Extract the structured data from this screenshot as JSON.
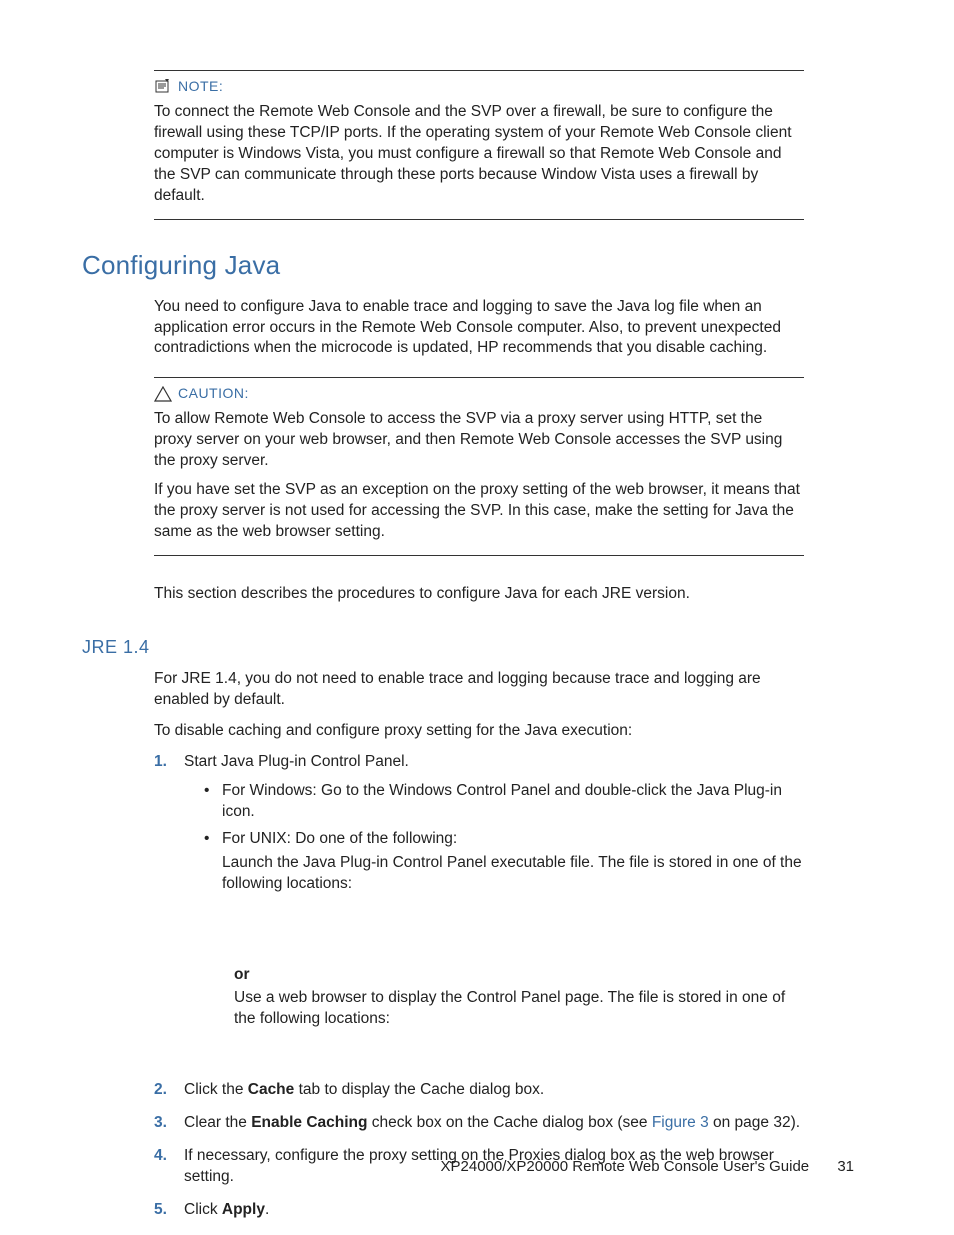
{
  "note": {
    "label": "NOTE:",
    "body": "To connect the Remote Web Console and the SVP over a firewall, be sure to configure the firewall using these TCP/IP ports. If the operating system of your Remote Web Console client computer is Windows Vista, you must configure a firewall so that Remote Web Console and the SVP can communicate through these ports because Window Vista uses a firewall by default."
  },
  "section": {
    "title": "Configuring Java",
    "intro": "You need to configure Java to enable trace and logging to save the Java log file when an application error occurs in the Remote Web Console computer. Also, to prevent unexpected contradictions when the microcode is updated, HP recommends that you disable caching."
  },
  "caution": {
    "label": "CAUTION:",
    "p1": "To allow Remote Web Console to access the SVP via a proxy server using HTTP, set the proxy server on your web browser, and then Remote Web Console accesses the SVP using the proxy server.",
    "p2": "If you have set the SVP as an exception on the proxy setting of the web browser, it means that the proxy server is not used for accessing the SVP. In this case, make the setting for Java the same as the web browser setting."
  },
  "after_caution": "This section describes the procedures to configure Java for each JRE version.",
  "jre": {
    "title": "JRE 1.4",
    "p1": "For JRE 1.4, you do not need to enable trace and logging because trace and logging are enabled by default.",
    "p2": "To disable caching and configure proxy setting for the Java execution:",
    "steps": {
      "s1": {
        "num": "1.",
        "text": "Start Java Plug-in Control Panel.",
        "b1": "For Windows: Go to the Windows Control Panel and double-click the Java Plug-in icon.",
        "b2a": "For UNIX: Do one of the following:",
        "b2b": "Launch the Java Plug-in Control Panel executable file. The file is stored in one of the following locations:",
        "or_label": "or",
        "or_text": "Use a web browser to display the Control Panel page. The file is stored in one of the following locations:"
      },
      "s2": {
        "num": "2.",
        "pre": "Click the ",
        "bold": "Cache",
        "post": " tab to display the Cache dialog box."
      },
      "s3": {
        "num": "3.",
        "pre": "Clear the ",
        "bold": "Enable Caching",
        "mid": " check box on the Cache dialog box (see ",
        "link": "Figure 3",
        "post": " on page 32)."
      },
      "s4": {
        "num": "4.",
        "text": "If necessary, configure the proxy setting on the Proxies dialog box as the web browser setting."
      },
      "s5": {
        "num": "5.",
        "pre": "Click ",
        "bold": "Apply",
        "post": "."
      }
    }
  },
  "footer": {
    "title": "XP24000/XP20000 Remote Web Console User's Guide",
    "page": "31"
  }
}
